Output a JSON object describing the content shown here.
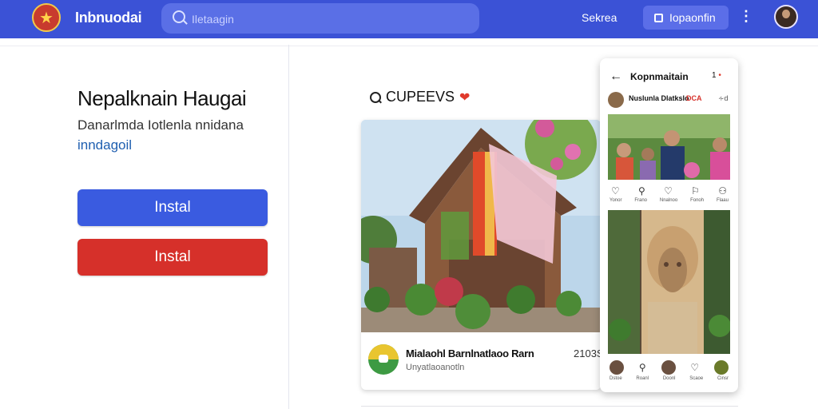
{
  "header": {
    "app_title": "Inbnuodai",
    "search_placeholder": "Iletaagin",
    "nav_link": "Sekrea",
    "nav_button": "Iopaonfin",
    "more": "⋮"
  },
  "hero": {
    "title": "Nepalknain Haugai",
    "subtitle": "Danarlmda Iotlenla nnidana",
    "link": "inndagoil",
    "button_primary": "Instal",
    "button_secondary": "Instal"
  },
  "feed": {
    "heading": "CUPEEVS",
    "post": {
      "title": "Mialaohl Barnlnatlaoo Rarn",
      "subtitle": "Unyatlaoanotln",
      "count": "2103S"
    }
  },
  "phone": {
    "title": "Kopnmaitain",
    "badge": "1",
    "user": "Nuslunla Dlatkslo",
    "user_tag": "DCA",
    "user_more": "∻d",
    "action_labels": [
      "Yonor",
      "Frano",
      "Nnalnoo",
      "Fonoh",
      "Flaau"
    ],
    "bottom_labels": [
      "Dstoe",
      "Roanl",
      "Doonl",
      "Scaoe",
      "Cinsr"
    ]
  },
  "colors": {
    "topbar": "#3b52d6",
    "primary_button": "#3a5be0",
    "secondary_button": "#d6302a",
    "link": "#1f5fb0"
  }
}
